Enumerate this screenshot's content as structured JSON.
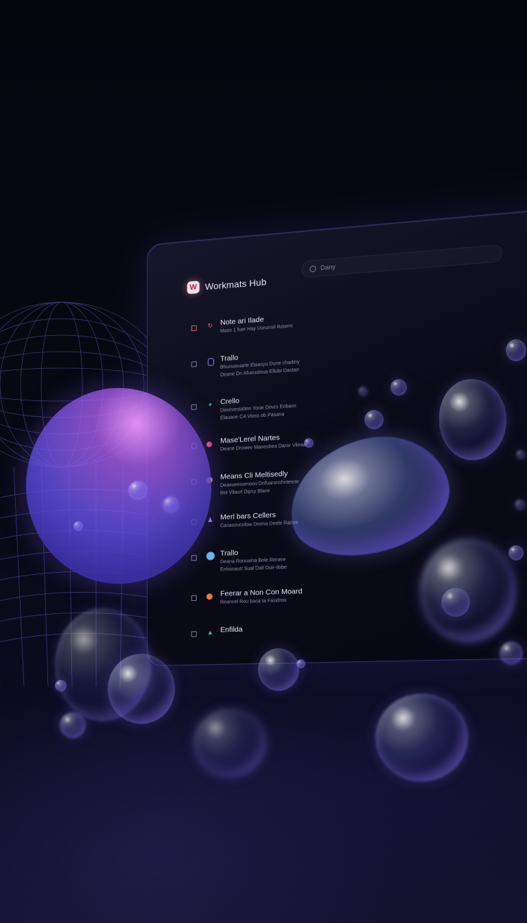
{
  "app": {
    "name": "Workmats Hub",
    "logo_letter": "W"
  },
  "search": {
    "placeholder": "Dany"
  },
  "list": [
    {
      "title": "Note ari Ilade",
      "sub": "Mass 1 fuer Hay Uurunsit Ilusons",
      "sub2": "",
      "icon": "refresh-icon",
      "icon_color": "#e25a6e"
    },
    {
      "title": "Trallo",
      "sub": "Bhunuiouarle Elaasyu Dune chadiny",
      "sub2": "Deane Dn Afuousloua Ellubr Dastan",
      "icon": "document-icon",
      "icon_color": "#8a86ff"
    },
    {
      "title": "Crello",
      "sub": "Dasovestatien Yorar Dovrs Enbass",
      "sub2": "Elauane CA Vioss ob Pasana",
      "icon": "star-icon",
      "icon_color": "#3bb08f"
    },
    {
      "title": "Mase'Lerel Nartes",
      "sub": "Deane Drowev Manesbea Daror Vileaal",
      "sub2": "",
      "icon": "badge-icon",
      "icon_color": "#d05080"
    },
    {
      "title": "Means Cli Meltisedly",
      "sub": "Deaxueesomoou Dnfuarsnshntesne",
      "sub2": "Rel Vllaorl Dipsy Blane",
      "icon": "avatar-icon",
      "icon_color": "#c89060"
    },
    {
      "title": "Merl bars Cellers",
      "sub": "Casasoucolow Donna Deele Ranoe",
      "sub2": "",
      "icon": "figure-icon",
      "icon_color": "#8c7cff"
    },
    {
      "title": "Trallo",
      "sub": "Deana Ronuaina Bole Renere",
      "sub2": "Enhonautr Sual Dall Ouir-Ilobe",
      "icon": "globe-icon",
      "icon_color": "#6fb4e8"
    },
    {
      "title": "Feerar a Non Con Moard",
      "sub": "Reancel Rou baca ta Fasidnta",
      "sub2": "",
      "icon": "avatar-icon",
      "icon_color": "#e07a4a"
    },
    {
      "title": "Enfilda",
      "sub": "",
      "sub2": "",
      "icon": "triangle-icon",
      "icon_color": "#4bc0b0"
    }
  ]
}
